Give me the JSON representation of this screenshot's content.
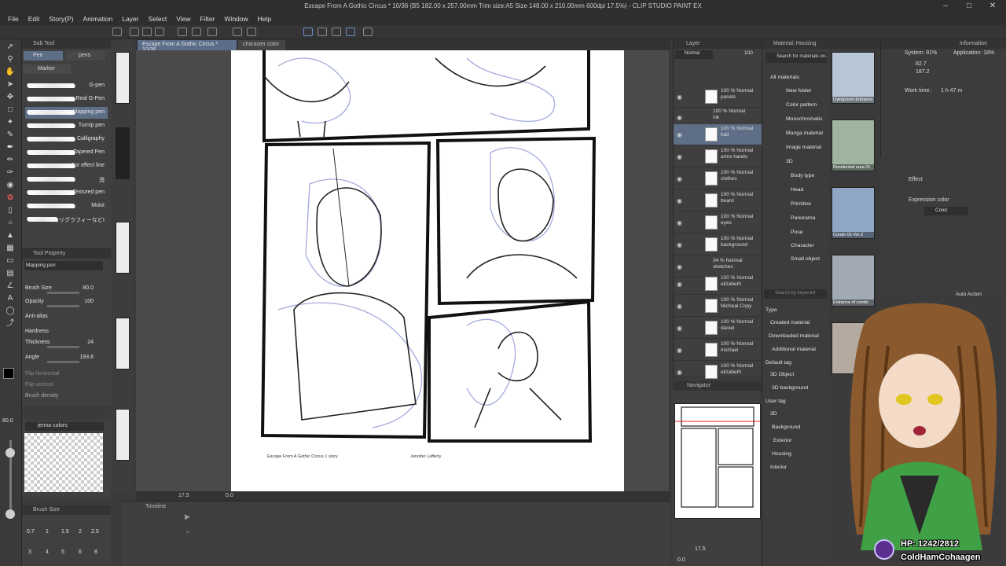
{
  "window": {
    "title": "Escape From A Gothic Circus * 10/36 (B5 182.00 x 257.00mm Trim size:A5 Size 148.00 x 210.00mm 600dpi 17.5%) - CLIP STUDIO PAINT EX"
  },
  "menu": [
    "File",
    "Edit",
    "Story(P)",
    "Animation",
    "Layer",
    "Select",
    "View",
    "Filter",
    "Window",
    "Help"
  ],
  "subtool": {
    "header": "Sub Tool",
    "tabs": [
      "Pen",
      "pens"
    ],
    "group": "Marker",
    "brushes": [
      "G-pen",
      "Real G-Pen",
      "Mapping pen",
      "Turnip pen",
      "Calligraphy",
      "Tapered Pen",
      "For effect line",
      "消",
      "Textured pen",
      "Moist",
      "カリグラフィーなどⅠ"
    ],
    "selected_index": 2
  },
  "tool_property": {
    "header": "Tool Property",
    "preset": "Mapping pen",
    "rows": [
      {
        "label": "Brush Size",
        "value": "80.0"
      },
      {
        "label": "Opacity",
        "value": "100"
      },
      {
        "label": "Anti-alias",
        "value": ""
      },
      {
        "label": "Hardness",
        "value": ""
      },
      {
        "label": "Thickness",
        "value": "24"
      },
      {
        "label": "Angle",
        "value": "193.8"
      },
      {
        "label": "Flip horizontal",
        "value": ""
      },
      {
        "label": "Flip vertical",
        "value": ""
      },
      {
        "label": "Brush density",
        "value": ""
      }
    ]
  },
  "color_set": {
    "name": "jenna colors"
  },
  "brush_size_panel": {
    "header": "Brush Size",
    "values": [
      "0.7",
      "1",
      "1.5",
      "2",
      "2.5",
      "3",
      "4",
      "5",
      "6",
      "8"
    ],
    "current": "80.0"
  },
  "canvas": {
    "tabs": [
      "Escape From A Gothic Circus * 10/36",
      "character color"
    ],
    "footer_left": "Escape From A Gothic Circus 1 story",
    "footer_right": "Jennifer Lafferty",
    "zoom": "17.5",
    "rotation": "0.0"
  },
  "timeline": {
    "header": "Timeline"
  },
  "layers": {
    "header": "Layer",
    "blend": "Normal",
    "opacity": "100",
    "items": [
      {
        "pct": "100 %",
        "mode": "Normal",
        "name": "panels",
        "folder": false
      },
      {
        "pct": "100 %",
        "mode": "Normal",
        "name": "ink",
        "folder": true
      },
      {
        "pct": "100 %",
        "mode": "Normal",
        "name": "hair",
        "folder": false,
        "selected": true
      },
      {
        "pct": "100 %",
        "mode": "Normal",
        "name": "arms hands",
        "folder": false
      },
      {
        "pct": "100 %",
        "mode": "Normal",
        "name": "clothes",
        "folder": false
      },
      {
        "pct": "100 %",
        "mode": "Normal",
        "name": "beard",
        "folder": false
      },
      {
        "pct": "100 %",
        "mode": "Normal",
        "name": "eyes",
        "folder": false
      },
      {
        "pct": "100 %",
        "mode": "Normal",
        "name": "background",
        "folder": false
      },
      {
        "pct": "34 %",
        "mode": "Normal",
        "name": "sketches",
        "folder": true
      },
      {
        "pct": "100 %",
        "mode": "Normal",
        "name": "elizabeth",
        "folder": false
      },
      {
        "pct": "100 %",
        "mode": "Normal",
        "name": "Micheal Copy",
        "folder": false
      },
      {
        "pct": "100 %",
        "mode": "Normal",
        "name": "daniel",
        "folder": false
      },
      {
        "pct": "100 %",
        "mode": "Normal",
        "name": "michael",
        "folder": false
      },
      {
        "pct": "100 %",
        "mode": "Normal",
        "name": "elizabeth",
        "folder": false
      }
    ]
  },
  "navigator": {
    "header": "Navigator",
    "zoom": "17.5",
    "rotation": "0.0"
  },
  "material": {
    "header": "Material: Housing",
    "search_placeholder": "Search for materials on ASSETS",
    "tree": [
      "All materials",
      "New folder",
      "Color pattern",
      "Monochromatic",
      "Manga material",
      "Image material",
      "3D",
      "Body type",
      "Head",
      "Primitive",
      "Panorama",
      "Pose",
      "Character",
      "Small object"
    ],
    "search2_placeholder": "Search by keyword",
    "type_header": "Type",
    "type_items": [
      "Created material",
      "Downloaded material",
      "Additional material"
    ],
    "default_tag_header": "Default tag",
    "default_tags": [
      "3D Object",
      "3D background"
    ],
    "user_tag_header": "User tag",
    "user_tags": [
      "3D",
      "Background",
      "Exterior",
      "Housing",
      "Interior"
    ],
    "thumbnails": [
      "Livingroom Entrance",
      "Residential area 01",
      "Condo 01-Ver.2",
      "Entrance of condo"
    ]
  },
  "info": {
    "header": "Information",
    "system": "System: 81%",
    "application": "Application: 18%",
    "x": "82.7",
    "y": "187.2",
    "work_time_label": "Work time:",
    "work_time": "1 h 47 m"
  },
  "effect": {
    "header": "Effect",
    "expression_label": "Expression color",
    "expression_value": "Color"
  },
  "auto_action": {
    "header": "Auto Action",
    "value": "Default"
  },
  "stream": {
    "hp": "HP: 1242/2812",
    "username": "ColdHamCohaagen"
  }
}
